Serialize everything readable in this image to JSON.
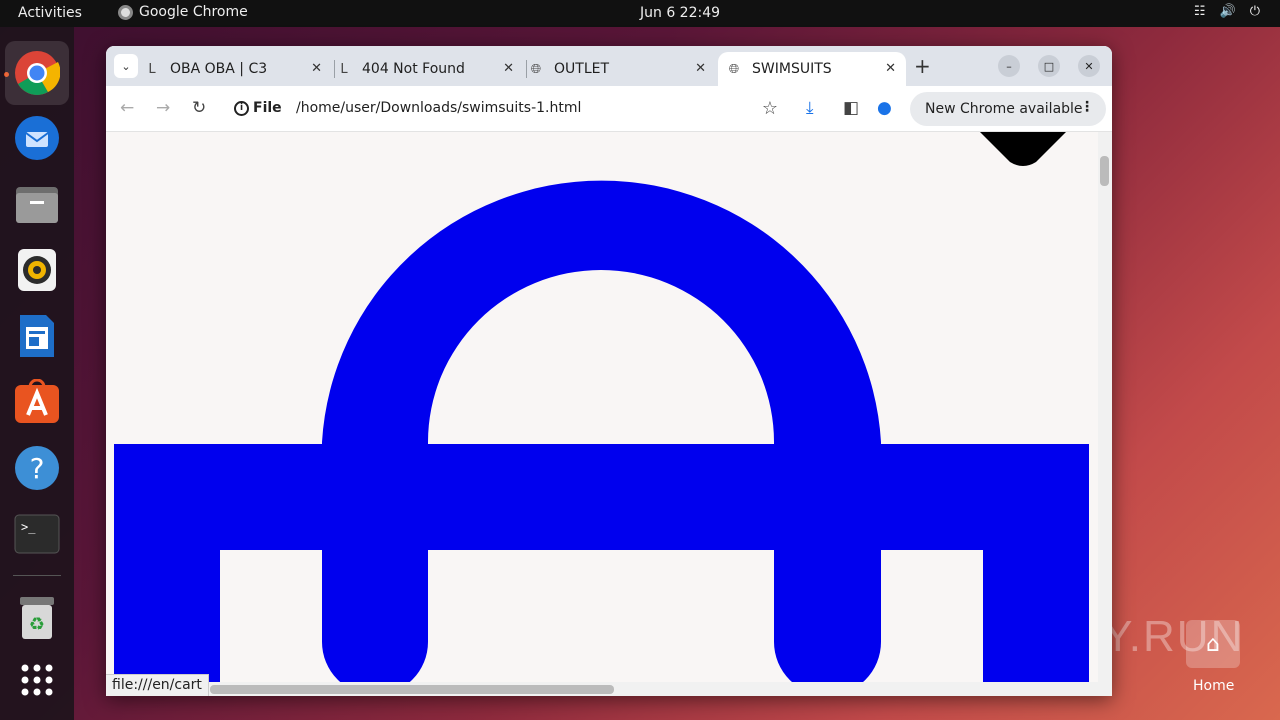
{
  "topbar": {
    "activities": "Activities",
    "app_name": "Google Chrome",
    "clock": "Jun 6  22:49",
    "tray_icons": [
      "network-icon",
      "volume-icon",
      "power-icon"
    ]
  },
  "dock": {
    "items": [
      "chrome-icon",
      "thunderbird-icon",
      "files-icon",
      "rhythmbox-icon",
      "writer-icon",
      "app-center-icon",
      "help-icon",
      "terminal-icon",
      "trash-icon",
      "app-grid-icon"
    ]
  },
  "browser": {
    "tabs": [
      {
        "title": "OBA OBA | C3",
        "favicon": "L"
      },
      {
        "title": "404 Not Found",
        "favicon": "L"
      },
      {
        "title": "OUTLET",
        "favicon": "globe"
      },
      {
        "title": "SWIMSUITS",
        "favicon": "globe",
        "active": true
      }
    ],
    "new_tab": "+",
    "address": {
      "scheme_label": "File",
      "url": "/home/user/Downloads/swimsuits-1.html"
    },
    "update_label": "New Chrome available",
    "status_url": "file:///en/cart",
    "colors": {
      "graphic": "#0000ee",
      "page_bg": "#f9f6f5"
    }
  },
  "desktop": {
    "watermark": "ANY.RUN",
    "home_label": "Home"
  }
}
